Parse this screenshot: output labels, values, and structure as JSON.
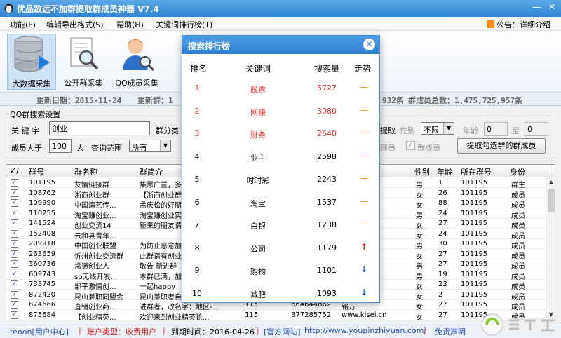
{
  "window": {
    "title": "优品致远不加群提取群成员神器  V7.4",
    "min": "—",
    "close": "✕"
  },
  "menu": {
    "items": [
      "功能(F)",
      "编辑导出格式(S)",
      "帮助(H)",
      "关键词排行榜(T)"
    ],
    "notice": "公告：详细介绍"
  },
  "toolbar": {
    "items": [
      {
        "label": "大数据采集",
        "icon": "database-icon"
      },
      {
        "label": "公开群采集",
        "icon": "magnifier-document-icon"
      },
      {
        "label": "QQ成员采集",
        "icon": "person-search-icon"
      }
    ]
  },
  "info": {
    "update_date": "更新日期：2015-11-24",
    "new_groups": "更新群：1",
    "tail_count": "932条",
    "members_total": "群成员总数：1,475,725,957条"
  },
  "search": {
    "group_label": "QQ群搜索设置",
    "keyword_label": "关 键 字",
    "keyword_value": "创业",
    "category_label": "群分类",
    "members_label": "成员大于",
    "members_value": "100",
    "members_unit": "人",
    "range_label": "查询范围",
    "range_value": "所有",
    "extract_label": "提取",
    "gender_label": "性别",
    "gender_value": "不限",
    "age_label": "年龄",
    "age_from": "0",
    "age_to_label": "至",
    "age_to": "0",
    "admin_label": "理员",
    "member_cb_label": "群成员",
    "extract_button": "提取勾选群的群成员"
  },
  "table": {
    "left_headers": [
      "群号",
      "群名称",
      "群简介"
    ],
    "right_headers": [
      "性别",
      "年龄",
      "所在群号",
      "身份"
    ],
    "left_rows": [
      [
        "101195",
        "友情链接群",
        "集思广益，多"
      ],
      [
        "108762",
        "浙商创业群",
        "【浙商创业群"
      ],
      [
        "109990",
        "中国清艺传...",
        "孟庆松的好朋"
      ],
      [
        "110255",
        "淘宝赚创业...",
        "淘宝赚创业实"
      ],
      [
        "141524",
        "创业交流14",
        "新来的朋友请"
      ],
      [
        "152408",
        "云和县青年...",
        ""
      ],
      [
        "209918",
        "中国创业联盟",
        "为防止恶意加"
      ],
      [
        "263659",
        "忻州创业交流群",
        "此群请有创业"
      ],
      [
        "360736",
        "常德创业人",
        "敬告 新进群"
      ],
      [
        "609743",
        "sp无线开发...",
        "本群已满，加"
      ],
      [
        "733745",
        "邹平激情创...",
        "一起happy"
      ],
      [
        "872420",
        "昆山兼职同盟会",
        "昆山兼职者自"
      ],
      [
        "874666",
        "直销创业商...",
        "进群者，改名字：地区-..."
      ],
      [
        "875684",
        "【创业精英...",
        "欢迎来到创业精英论..."
      ]
    ],
    "mid_rows": [
      [
        "",
        ""
      ],
      [
        "",
        ""
      ],
      [
        "",
        ""
      ],
      [
        "",
        ""
      ],
      [
        "",
        ""
      ],
      [
        "",
        "索"
      ],
      [
        "",
        "线"
      ],
      [
        "",
        "网"
      ],
      [
        "",
        "南"
      ],
      [
        "",
        ""
      ],
      [
        "",
        ""
      ],
      [
        "",
        "头"
      ],
      [
        "664644862",
        "铭万"
      ],
      [
        "377285752",
        "www.kisei.cn"
      ]
    ],
    "mid_extra": [
      "115",
      "115"
    ],
    "right_rows": [
      [
        "男",
        "1",
        "101195",
        "群主"
      ],
      [
        "女",
        "26",
        "101195",
        "成员"
      ],
      [
        "女",
        "88",
        "101195",
        "成员"
      ],
      [
        "男",
        "24",
        "101195",
        "成员"
      ],
      [
        "女",
        "27",
        "101195",
        "成员"
      ],
      [
        "女",
        "24",
        "101195",
        "成员"
      ],
      [
        "男",
        "30",
        "101195",
        "成员"
      ],
      [
        "女",
        "27",
        "101195",
        "成员"
      ],
      [
        "男",
        "27",
        "101195",
        "成员"
      ],
      [
        "男",
        "19",
        "101195",
        "成员"
      ],
      [
        "女",
        "23",
        "101195",
        "成员"
      ],
      [
        "女",
        "2",
        "101195",
        "成员"
      ],
      [
        "女",
        "27",
        "101195",
        "成员"
      ],
      [
        "女",
        "27",
        "101195",
        "成员"
      ]
    ]
  },
  "popup": {
    "title": "搜索排行榜",
    "headers": [
      "排名",
      "关键词",
      "搜索量",
      "走势"
    ],
    "rows": [
      {
        "rank": "1",
        "keyword": "股票",
        "volume": "5727",
        "trend": "—"
      },
      {
        "rank": "2",
        "keyword": "网赚",
        "volume": "3080",
        "trend": "—"
      },
      {
        "rank": "3",
        "keyword": "财务",
        "volume": "2640",
        "trend": "—"
      },
      {
        "rank": "4",
        "keyword": "业主",
        "volume": "2598",
        "trend": "—"
      },
      {
        "rank": "5",
        "keyword": "时时彩",
        "volume": "2243",
        "trend": "—"
      },
      {
        "rank": "6",
        "keyword": "淘宝",
        "volume": "1537",
        "trend": "—"
      },
      {
        "rank": "7",
        "keyword": "白银",
        "volume": "1238",
        "trend": "—"
      },
      {
        "rank": "8",
        "keyword": "公司",
        "volume": "1179",
        "trend": "↑"
      },
      {
        "rank": "9",
        "keyword": "购物",
        "volume": "1101",
        "trend": "↓"
      },
      {
        "rank": "10",
        "keyword": "减肥",
        "volume": "1093",
        "trend": "↓"
      }
    ]
  },
  "status": {
    "user": "reoon[用户中心]",
    "sep1": "|",
    "account": "账户类型：收费用户",
    "sep2": "|",
    "expire": "到期时间：2016-04-26",
    "sep3": "|",
    "site_label": "[官方网站]",
    "site_url": "http://www.youpinzhiyuan.com/",
    "sep4": "|",
    "disclaimer": "免责声明"
  },
  "colors": {
    "title_blue": "#2f86d2",
    "accent_red": "#e83131",
    "trend_flat": "#f09a1a",
    "trend_down": "#1f57c9"
  }
}
